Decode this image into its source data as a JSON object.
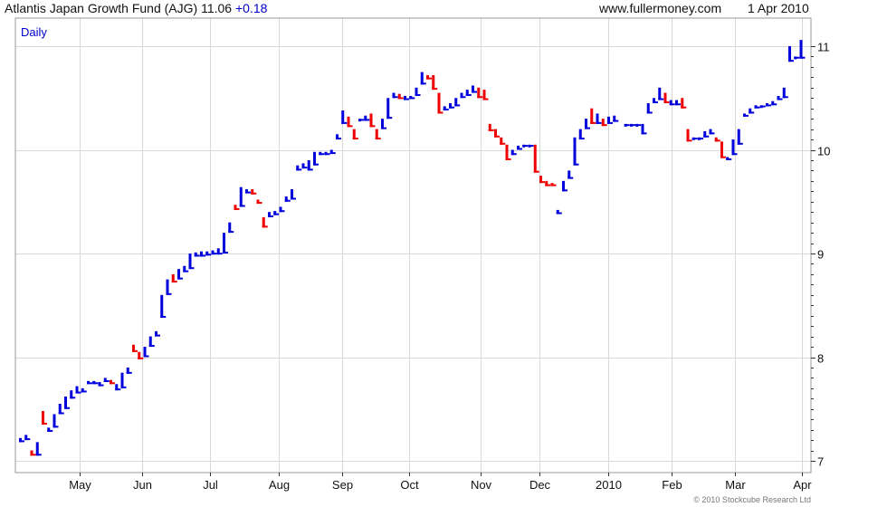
{
  "header": {
    "title": "Atlantis Japan Growth Fund (AJG) 11.06",
    "change": "+0.18",
    "site": "www.fullermoney.com",
    "date": "1 Apr 2010",
    "period": "Daily",
    "copyright": "© 2010 Stockcube Research Ltd"
  },
  "colors": {
    "up": "#0000dd",
    "down": "#ee0000",
    "grid": "#d8d8d8",
    "axis": "#333333"
  },
  "chart_data": {
    "type": "bar",
    "title": "Atlantis Japan Growth Fund (AJG) 11.06 +0.18",
    "ylim": [
      6.94,
      11.12
    ],
    "xlim": [
      0,
      118
    ],
    "yticks": [
      7,
      8,
      9,
      10,
      11
    ],
    "ytick_labels": [
      "7",
      "8",
      "9",
      "10",
      "11"
    ],
    "grid": true,
    "months": [
      {
        "label": "May",
        "x": 10
      },
      {
        "label": "Jun",
        "x": 20
      },
      {
        "label": "Jul",
        "x": 30.5
      },
      {
        "label": "Aug",
        "x": 41
      },
      {
        "label": "Sep",
        "x": 51.5
      },
      {
        "label": "Oct",
        "x": 61.5
      },
      {
        "label": "Nov",
        "x": 72.5
      },
      {
        "label": "Dec",
        "x": 82.5
      },
      {
        "label": "2010",
        "x": 92.5
      },
      {
        "label": "Feb",
        "x": 102.5
      },
      {
        "label": "Mar",
        "x": 112
      },
      {
        "label": "Apr",
        "x": 122
      }
    ],
    "bars": [
      [
        0,
        7.22,
        7.18,
        "up"
      ],
      [
        1,
        7.25,
        7.2,
        "up"
      ],
      [
        2,
        7.1,
        7.05,
        "down"
      ],
      [
        3,
        7.18,
        7.05,
        "up"
      ],
      [
        4,
        7.48,
        7.35,
        "down"
      ],
      [
        5,
        7.32,
        7.28,
        "up"
      ],
      [
        6,
        7.45,
        7.32,
        "up"
      ],
      [
        7,
        7.55,
        7.45,
        "up"
      ],
      [
        8,
        7.62,
        7.5,
        "up"
      ],
      [
        9,
        7.68,
        7.6,
        "up"
      ],
      [
        10,
        7.72,
        7.65,
        "up"
      ],
      [
        11,
        7.7,
        7.66,
        "up"
      ],
      [
        12,
        7.77,
        7.74,
        "up"
      ],
      [
        13,
        7.77,
        7.74,
        "up"
      ],
      [
        14,
        7.76,
        7.72,
        "up"
      ],
      [
        15,
        7.8,
        7.76,
        "up"
      ],
      [
        16,
        7.78,
        7.74,
        "down"
      ],
      [
        17,
        7.74,
        7.68,
        "up"
      ],
      [
        18,
        7.85,
        7.7,
        "up"
      ],
      [
        19,
        7.9,
        7.84,
        "up"
      ],
      [
        20,
        8.12,
        8.05,
        "down"
      ],
      [
        21,
        8.05,
        7.98,
        "down"
      ],
      [
        22,
        8.1,
        8.0,
        "up"
      ],
      [
        23,
        8.2,
        8.1,
        "up"
      ],
      [
        24,
        8.25,
        8.2,
        "up"
      ],
      [
        25,
        8.6,
        8.38,
        "up"
      ],
      [
        26,
        8.75,
        8.6,
        "up"
      ],
      [
        27,
        8.8,
        8.72,
        "down"
      ],
      [
        28,
        8.85,
        8.75,
        "up"
      ],
      [
        29,
        8.88,
        8.82,
        "up"
      ],
      [
        30,
        9.0,
        8.85,
        "up"
      ],
      [
        31,
        9.01,
        8.97,
        "up"
      ],
      [
        32,
        9.02,
        8.97,
        "up"
      ],
      [
        33,
        9.02,
        8.98,
        "up"
      ],
      [
        34,
        9.03,
        8.99,
        "up"
      ],
      [
        35,
        9.05,
        8.99,
        "up"
      ],
      [
        36,
        9.2,
        9.0,
        "up"
      ],
      [
        37,
        9.3,
        9.2,
        "up"
      ],
      [
        38,
        9.47,
        9.42,
        "down"
      ],
      [
        39,
        9.64,
        9.45,
        "up"
      ],
      [
        40,
        9.62,
        9.58,
        "up"
      ],
      [
        41,
        9.62,
        9.57,
        "down"
      ],
      [
        42,
        9.52,
        9.48,
        "down"
      ],
      [
        43,
        9.35,
        9.25,
        "down"
      ],
      [
        44,
        9.4,
        9.35,
        "up"
      ],
      [
        45,
        9.41,
        9.37,
        "up"
      ],
      [
        46,
        9.45,
        9.4,
        "up"
      ],
      [
        47,
        9.55,
        9.5,
        "up"
      ],
      [
        48,
        9.62,
        9.52,
        "up"
      ],
      [
        49,
        9.85,
        9.8,
        "up"
      ],
      [
        50,
        9.87,
        9.82,
        "up"
      ],
      [
        51,
        9.9,
        9.8,
        "up"
      ],
      [
        52,
        9.98,
        9.85,
        "up"
      ],
      [
        53,
        9.98,
        9.95,
        "up"
      ],
      [
        54,
        9.98,
        9.95,
        "up"
      ],
      [
        55,
        10.0,
        9.96,
        "up"
      ],
      [
        56,
        10.15,
        10.1,
        "up"
      ],
      [
        57,
        10.38,
        10.25,
        "up"
      ],
      [
        58,
        10.32,
        10.22,
        "down"
      ],
      [
        59,
        10.2,
        10.1,
        "down"
      ],
      [
        60,
        10.3,
        10.28,
        "up"
      ],
      [
        61,
        10.33,
        10.28,
        "up"
      ],
      [
        62,
        10.35,
        10.22,
        "down"
      ],
      [
        63,
        10.2,
        10.1,
        "down"
      ],
      [
        64,
        10.3,
        10.2,
        "up"
      ],
      [
        65,
        10.5,
        10.3,
        "up"
      ],
      [
        66,
        10.55,
        10.5,
        "up"
      ],
      [
        67,
        10.54,
        10.49,
        "down"
      ],
      [
        68,
        10.52,
        10.48,
        "up"
      ],
      [
        69,
        10.52,
        10.49,
        "up"
      ],
      [
        70,
        10.6,
        10.52,
        "up"
      ],
      [
        71,
        10.75,
        10.63,
        "up"
      ],
      [
        72,
        10.72,
        10.68,
        "down"
      ],
      [
        73,
        10.72,
        10.58,
        "down"
      ],
      [
        74,
        10.55,
        10.35,
        "down"
      ],
      [
        75,
        10.42,
        10.38,
        "up"
      ],
      [
        76,
        10.45,
        10.4,
        "up"
      ],
      [
        77,
        10.5,
        10.42,
        "up"
      ],
      [
        78,
        10.55,
        10.5,
        "up"
      ],
      [
        79,
        10.58,
        10.52,
        "up"
      ],
      [
        80,
        10.62,
        10.55,
        "up"
      ],
      [
        81,
        10.6,
        10.5,
        "down"
      ],
      [
        82,
        10.58,
        10.48,
        "down"
      ],
      [
        83,
        10.25,
        10.18,
        "down"
      ],
      [
        84,
        10.2,
        10.12,
        "down"
      ],
      [
        85,
        10.12,
        10.05,
        "down"
      ],
      [
        86,
        10.05,
        9.9,
        "down"
      ],
      [
        87,
        10.0,
        9.95,
        "up"
      ],
      [
        88,
        10.04,
        10.0,
        "up"
      ],
      [
        89,
        10.05,
        10.03,
        "up"
      ],
      [
        90,
        10.05,
        10.03,
        "up"
      ],
      [
        91,
        10.05,
        9.78,
        "down"
      ],
      [
        92,
        9.75,
        9.68,
        "down"
      ],
      [
        93,
        9.7,
        9.65,
        "down"
      ],
      [
        94,
        9.68,
        9.65,
        "down"
      ],
      [
        95,
        9.42,
        9.38,
        "up"
      ],
      [
        96,
        9.7,
        9.6,
        "up"
      ],
      [
        97,
        9.8,
        9.72,
        "up"
      ],
      [
        98,
        10.12,
        9.85,
        "up"
      ],
      [
        99,
        10.2,
        10.1,
        "up"
      ],
      [
        100,
        10.3,
        10.2,
        "up"
      ],
      [
        101,
        10.4,
        10.25,
        "down"
      ],
      [
        102,
        10.35,
        10.25,
        "up"
      ],
      [
        103,
        10.3,
        10.23,
        "down"
      ],
      [
        104,
        10.32,
        10.25,
        "up"
      ],
      [
        105,
        10.33,
        10.27,
        "up"
      ]
    ],
    "bars2": [
      [
        107,
        10.25,
        10.23,
        "up"
      ],
      [
        108,
        10.25,
        10.23,
        "up"
      ],
      [
        109,
        10.25,
        10.23,
        "up"
      ],
      [
        110,
        10.25,
        10.15,
        "up"
      ],
      [
        111,
        10.45,
        10.35,
        "up"
      ],
      [
        112,
        10.5,
        10.45,
        "up"
      ],
      [
        113,
        10.6,
        10.48,
        "up"
      ],
      [
        114,
        10.55,
        10.45,
        "down"
      ],
      [
        115,
        10.48,
        10.43,
        "up"
      ],
      [
        116,
        10.48,
        10.43,
        "up"
      ],
      [
        117,
        10.5,
        10.4,
        "down"
      ],
      [
        118,
        10.2,
        10.08,
        "down"
      ],
      [
        119,
        10.12,
        10.1,
        "up"
      ],
      [
        120,
        10.12,
        10.1,
        "up"
      ],
      [
        121,
        10.18,
        10.12,
        "up"
      ],
      [
        122,
        10.2,
        10.15,
        "up"
      ],
      [
        123,
        10.12,
        10.08,
        "down"
      ],
      [
        124,
        10.08,
        9.92,
        "down"
      ],
      [
        125,
        9.93,
        9.9,
        "up"
      ],
      [
        126,
        10.1,
        9.95,
        "up"
      ],
      [
        127,
        10.2,
        10.05,
        "up"
      ],
      [
        128,
        10.35,
        10.32,
        "up"
      ],
      [
        129,
        10.4,
        10.35,
        "up"
      ],
      [
        130,
        10.43,
        10.4,
        "up"
      ],
      [
        131,
        10.43,
        10.41,
        "up"
      ],
      [
        132,
        10.45,
        10.42,
        "up"
      ],
      [
        133,
        10.47,
        10.43,
        "up"
      ],
      [
        134,
        10.52,
        10.48,
        "up"
      ],
      [
        135,
        10.6,
        10.5,
        "up"
      ],
      [
        136,
        11.0,
        10.85,
        "up"
      ],
      [
        137,
        10.9,
        10.88,
        "up"
      ],
      [
        138,
        11.06,
        10.88,
        "up"
      ]
    ]
  }
}
